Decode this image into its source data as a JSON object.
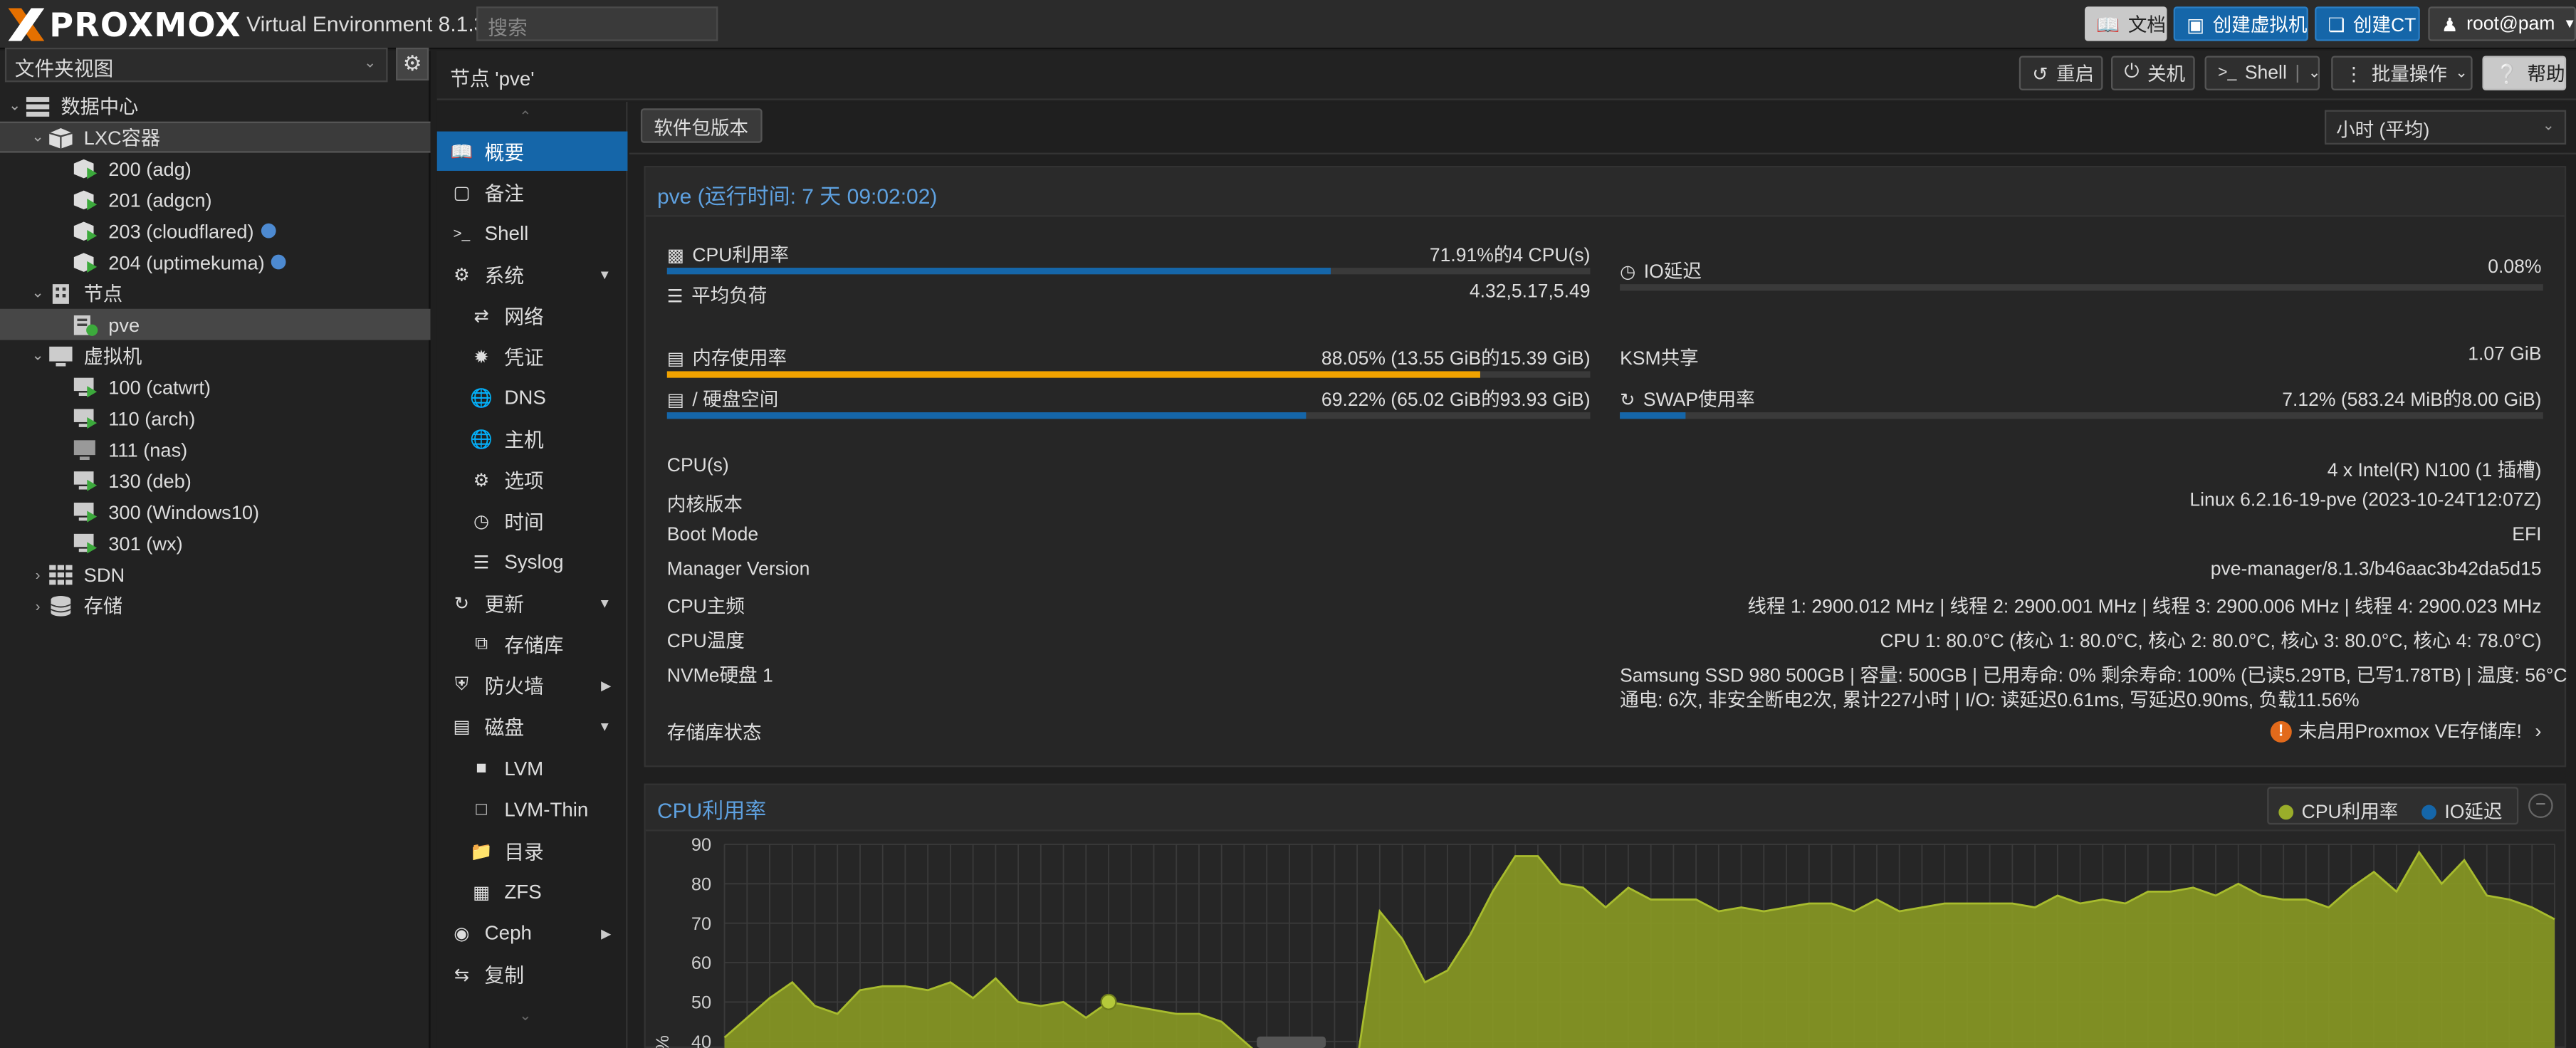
{
  "topbar": {
    "logo": "PROXMOX",
    "product": "Virtual Environment 8.1.3",
    "search_placeholder": "搜索",
    "docs": "文档",
    "create_vm": "创建虚拟机",
    "create_ct": "创建CT",
    "user": "root@pam"
  },
  "tree": {
    "view": "文件夹视图",
    "items": [
      {
        "label": "数据中心"
      },
      {
        "label": "LXC容器"
      },
      {
        "label": "200 (adg)"
      },
      {
        "label": "201 (adgcn)"
      },
      {
        "label": "203 (cloudflared)"
      },
      {
        "label": "204 (uptimekuma)"
      },
      {
        "label": "节点"
      },
      {
        "label": "pve"
      },
      {
        "label": "虚拟机"
      },
      {
        "label": "100 (catwrt)"
      },
      {
        "label": "110 (arch)"
      },
      {
        "label": "111 (nas)"
      },
      {
        "label": "130 (deb)"
      },
      {
        "label": "300 (Windows10)"
      },
      {
        "label": "301 (wx)"
      },
      {
        "label": "SDN"
      },
      {
        "label": "存储"
      }
    ]
  },
  "node_header": {
    "title": "节点 'pve'",
    "reboot": "重启",
    "shutdown": "关机",
    "shell": "Shell",
    "bulk": "批量操作",
    "help": "帮助"
  },
  "menu": [
    {
      "label": "概要"
    },
    {
      "label": "备注"
    },
    {
      "label": "Shell"
    },
    {
      "label": "系统"
    },
    {
      "label": "网络"
    },
    {
      "label": "凭证"
    },
    {
      "label": "DNS"
    },
    {
      "label": "主机"
    },
    {
      "label": "选项"
    },
    {
      "label": "时间"
    },
    {
      "label": "Syslog"
    },
    {
      "label": "更新"
    },
    {
      "label": "存储库"
    },
    {
      "label": "防火墙"
    },
    {
      "label": "磁盘"
    },
    {
      "label": "LVM"
    },
    {
      "label": "LVM-Thin"
    },
    {
      "label": "目录"
    },
    {
      "label": "ZFS"
    },
    {
      "label": "Ceph"
    },
    {
      "label": "复制"
    }
  ],
  "toolbar": {
    "package_versions": "软件包版本",
    "timeframe": "小时 (平均)"
  },
  "status": {
    "title": "pve (运行时间: 7 天 09:02:02)",
    "cpu_label": "CPU利用率",
    "cpu_value": "71.91%的4 CPU(s)",
    "cpu_pct": 0.7191,
    "load_label": "平均负荷",
    "load_value": "4.32,5.17,5.49",
    "io_label": "IO延迟",
    "io_value": "0.08%",
    "mem_label": "内存使用率",
    "mem_value": "88.05% (13.55 GiB的15.39 GiB)",
    "mem_pct": 0.8805,
    "ksm_label": "KSM共享",
    "ksm_value": "1.07 GiB",
    "disk_label": "/ 硬盘空间",
    "disk_value": "69.22% (65.02 GiB的93.93 GiB)",
    "disk_pct": 0.6922,
    "swap_label": "SWAP使用率",
    "swap_value": "7.12% (583.24 MiB的8.00 GiB)",
    "swap_pct": 0.0712,
    "colors": {
      "cpu": "#1566a9",
      "mem": "#f0a200",
      "disk": "#1566a9",
      "swap": "#1566a9"
    }
  },
  "info": [
    {
      "label": "CPU(s)",
      "value": "4 x Intel(R) N100 (1 插槽)"
    },
    {
      "label": "内核版本",
      "value": "Linux 6.2.16-19-pve (2023-10-24T12:07Z)"
    },
    {
      "label": "Boot Mode",
      "value": "EFI"
    },
    {
      "label": "Manager Version",
      "value": "pve-manager/8.1.3/b46aac3b42da5d15"
    },
    {
      "label": "CPU主频",
      "value": "线程 1: 2900.012 MHz | 线程 2: 2900.001 MHz | 线程 3: 2900.006 MHz | 线程 4: 2900.023 MHz"
    },
    {
      "label": "CPU温度",
      "value": "CPU 1: 80.0°C (核心 1: 80.0°C, 核心 2: 80.0°C, 核心 3: 80.0°C, 核心 4: 78.0°C)"
    },
    {
      "label": "NVMe硬盘 1",
      "value": "Samsung SSD 980 500GB | 容量: 500GB | 已用寿命: 0% 剩余寿命: 100% (已读5.29TB, 已写1.78TB) | 温度: 56°C",
      "value2": "通电: 6次, 非安全断电2次, 累计227小时 | I/O: 读延迟0.61ms, 写延迟0.90ms, 负载11.56%"
    },
    {
      "label": "存储库状态",
      "value": "未启用Proxmox VE存储库!"
    }
  ],
  "chart_data": {
    "type": "area",
    "title": "CPU利用率",
    "ylabel": "%",
    "ylim": [
      40,
      90
    ],
    "yticks": [
      40,
      50,
      60,
      70,
      80,
      90
    ],
    "legend": [
      "CPU利用率",
      "IO延迟"
    ],
    "colors": {
      "cpu": "#9aad2a",
      "io": "#1566a9"
    },
    "series": [
      {
        "name": "CPU利用率",
        "values": [
          41,
          46,
          51,
          55,
          49,
          47,
          53,
          54,
          54,
          53,
          55,
          51,
          56,
          50,
          49,
          50,
          46,
          50,
          49,
          48,
          47,
          47,
          45,
          40,
          35,
          35,
          35,
          35,
          35,
          73,
          66,
          55,
          58,
          67,
          78,
          87,
          87,
          80,
          79,
          74,
          79,
          76,
          76,
          76,
          73,
          74,
          73,
          74,
          75,
          75,
          73,
          76,
          73,
          74,
          75,
          75,
          75,
          75,
          74,
          77,
          75,
          76,
          75,
          78,
          78,
          79,
          77,
          80,
          77,
          76,
          76,
          74,
          79,
          83,
          78,
          88,
          80,
          86,
          77,
          76,
          74,
          71
        ]
      }
    ]
  }
}
